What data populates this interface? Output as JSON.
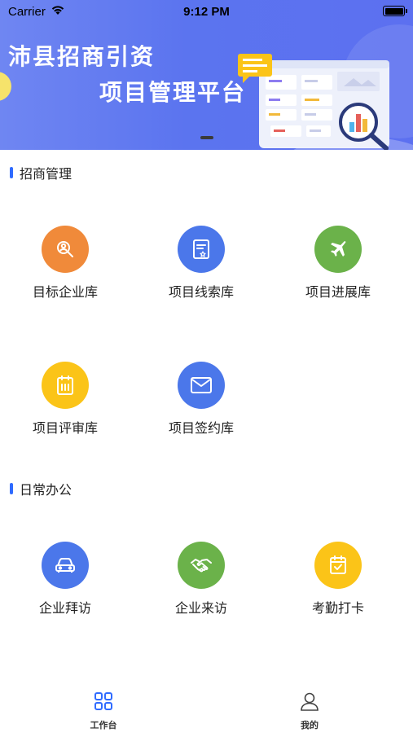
{
  "status_bar": {
    "carrier": "Carrier",
    "time": "9:12 PM"
  },
  "banner": {
    "title_line1": "沛县招商引资",
    "title_line2": "项目管理平台"
  },
  "sections": [
    {
      "title": "招商管理",
      "items": [
        {
          "label": "目标企业库",
          "icon": "search-people-icon",
          "color": "#f08a3a"
        },
        {
          "label": "项目线索库",
          "icon": "document-star-icon",
          "color": "#4b77ea"
        },
        {
          "label": "项目进展库",
          "icon": "airplane-icon",
          "color": "#6bb24a"
        },
        {
          "label": "项目评审库",
          "icon": "calendar-clipboard-icon",
          "color": "#fbc418"
        },
        {
          "label": "项目签约库",
          "icon": "mail-icon",
          "color": "#4b77ea"
        }
      ]
    },
    {
      "title": "日常办公",
      "items": [
        {
          "label": "企业拜访",
          "icon": "car-icon",
          "color": "#4b77ea"
        },
        {
          "label": "企业来访",
          "icon": "handshake-icon",
          "color": "#6bb24a"
        },
        {
          "label": "考勤打卡",
          "icon": "calendar-check-icon",
          "color": "#fbc418"
        }
      ]
    }
  ],
  "tabbar": {
    "tabs": [
      {
        "label": "工作台",
        "icon": "grid-icon",
        "active": true
      },
      {
        "label": "我的",
        "icon": "user-icon",
        "active": false
      }
    ],
    "active_color": "#2f6bff",
    "inactive_color": "#333333"
  },
  "colors": {
    "accent": "#2f6bff",
    "banner": "#5b74ef"
  }
}
